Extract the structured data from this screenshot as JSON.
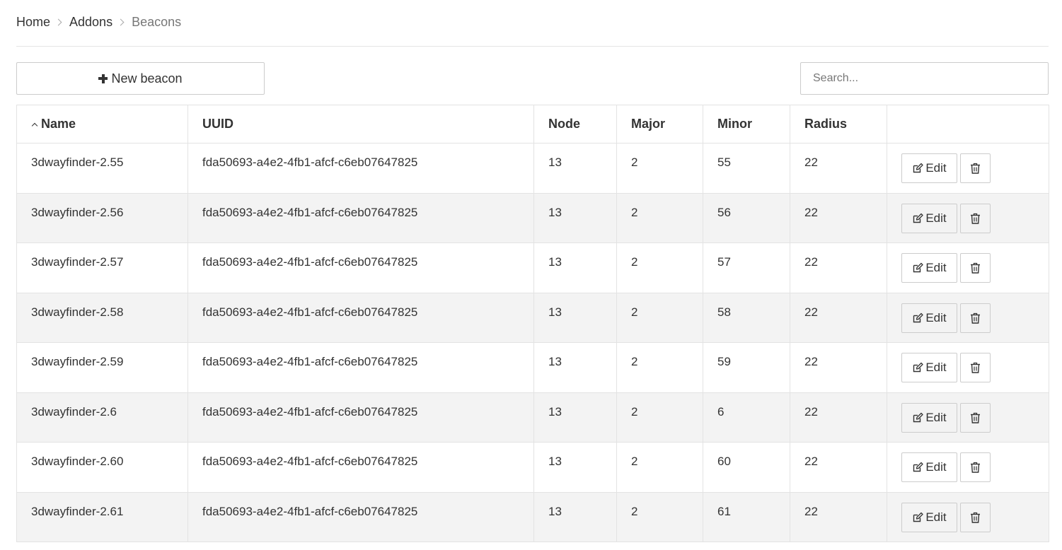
{
  "breadcrumb": {
    "home": "Home",
    "addons": "Addons",
    "current": "Beacons"
  },
  "toolbar": {
    "new_label": "New beacon",
    "search_placeholder": "Search..."
  },
  "table": {
    "headers": {
      "name": "Name",
      "uuid": "UUID",
      "node": "Node",
      "major": "Major",
      "minor": "Minor",
      "radius": "Radius"
    },
    "edit_label": "Edit",
    "rows": [
      {
        "name": "3dwayfinder-2.55",
        "uuid": "fda50693-a4e2-4fb1-afcf-c6eb07647825",
        "node": "13",
        "major": "2",
        "minor": "55",
        "radius": "22"
      },
      {
        "name": "3dwayfinder-2.56",
        "uuid": "fda50693-a4e2-4fb1-afcf-c6eb07647825",
        "node": "13",
        "major": "2",
        "minor": "56",
        "radius": "22"
      },
      {
        "name": "3dwayfinder-2.57",
        "uuid": "fda50693-a4e2-4fb1-afcf-c6eb07647825",
        "node": "13",
        "major": "2",
        "minor": "57",
        "radius": "22"
      },
      {
        "name": "3dwayfinder-2.58",
        "uuid": "fda50693-a4e2-4fb1-afcf-c6eb07647825",
        "node": "13",
        "major": "2",
        "minor": "58",
        "radius": "22"
      },
      {
        "name": "3dwayfinder-2.59",
        "uuid": "fda50693-a4e2-4fb1-afcf-c6eb07647825",
        "node": "13",
        "major": "2",
        "minor": "59",
        "radius": "22"
      },
      {
        "name": "3dwayfinder-2.6",
        "uuid": "fda50693-a4e2-4fb1-afcf-c6eb07647825",
        "node": "13",
        "major": "2",
        "minor": "6",
        "radius": "22"
      },
      {
        "name": "3dwayfinder-2.60",
        "uuid": "fda50693-a4e2-4fb1-afcf-c6eb07647825",
        "node": "13",
        "major": "2",
        "minor": "60",
        "radius": "22"
      },
      {
        "name": "3dwayfinder-2.61",
        "uuid": "fda50693-a4e2-4fb1-afcf-c6eb07647825",
        "node": "13",
        "major": "2",
        "minor": "61",
        "radius": "22"
      }
    ]
  }
}
